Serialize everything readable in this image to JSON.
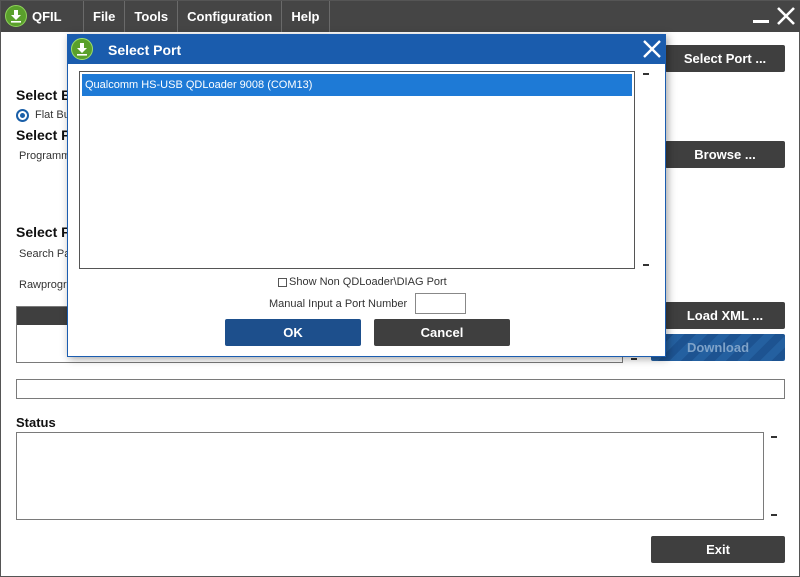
{
  "app": {
    "name": "QFIL",
    "menu": [
      "File",
      "Tools",
      "Configuration",
      "Help"
    ]
  },
  "background": {
    "select_heading_1": "Select B",
    "radio_label": "Flat Bu",
    "select_heading_2": "Select P",
    "programmer_label": "Programme",
    "select_heading_3": "Select F",
    "search_label": "Search Pa",
    "rawprogram_label": "Rawprogra",
    "status_heading": "Status",
    "buttons": {
      "select_port": "Select Port ...",
      "browse": "Browse ...",
      "load_xml": "Load XML ...",
      "download": "Download",
      "exit": "Exit"
    }
  },
  "dialog": {
    "title": "Select Port",
    "ports": [
      "Qualcomm HS-USB QDLoader 9008 (COM13)"
    ],
    "show_non_qdloader_label": "Show Non QDLoader\\DIAG Port",
    "manual_input_label": "Manual Input a Port Number",
    "manual_input_value": "",
    "ok_label": "OK",
    "cancel_label": "Cancel"
  },
  "colors": {
    "titlebar": "#454545",
    "dialog_title": "#1a5cad",
    "selection": "#1e7ad6",
    "ok_button": "#1d4f8c",
    "dark_button": "#3f3f3f",
    "logo_green": "#5aa02c"
  },
  "icons": {
    "app_logo": "download-arrow-icon",
    "close": "close-icon",
    "minimize": "minimize-icon"
  }
}
